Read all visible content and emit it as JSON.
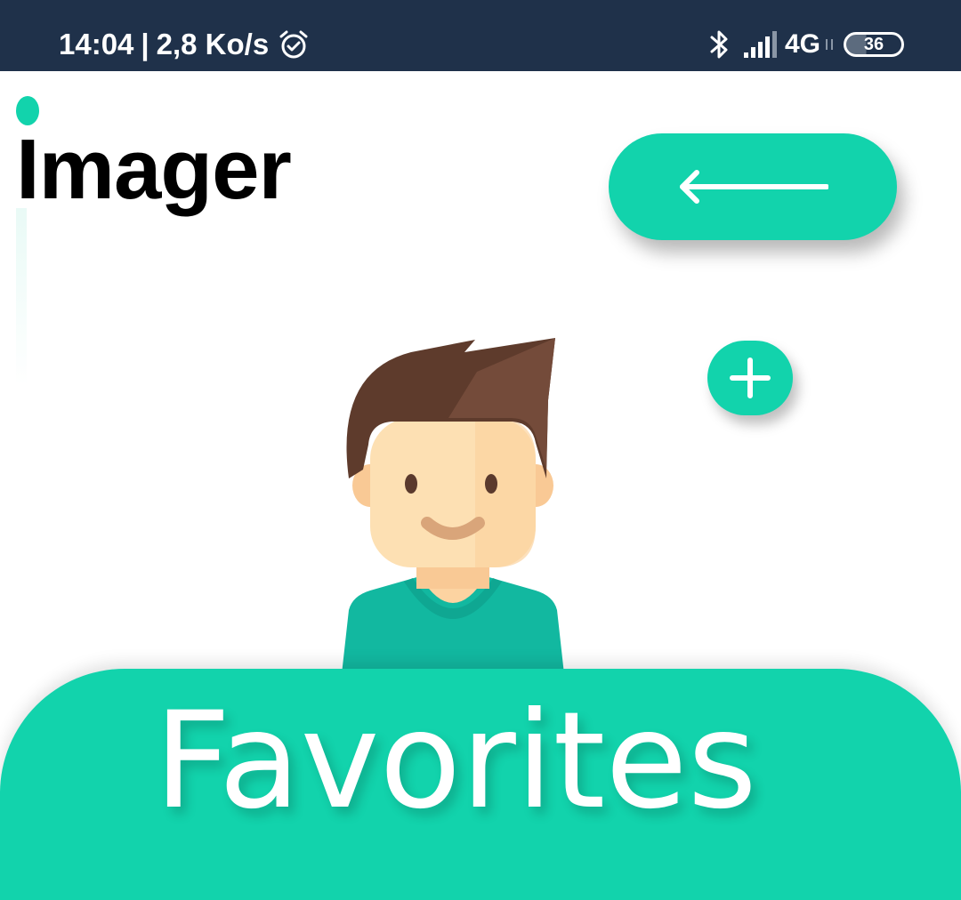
{
  "status_bar": {
    "time": "14:04",
    "separator": "|",
    "network_speed": "2,8 Ko/s",
    "network_type": "4G",
    "battery_level": "36",
    "background_color": "#1f314a",
    "icons": [
      "alarm-icon",
      "bluetooth-icon",
      "signal-icon",
      "data-arrows-icon",
      "battery-icon"
    ]
  },
  "app": {
    "logo_text": "Imager",
    "accent_color": "#12d3ac"
  },
  "controls": {
    "back_icon": "back-arrow-icon",
    "add_icon": "plus-icon"
  },
  "profile": {
    "avatar_icon": "user-avatar-illustration"
  },
  "favorites": {
    "label": "Favorites"
  }
}
